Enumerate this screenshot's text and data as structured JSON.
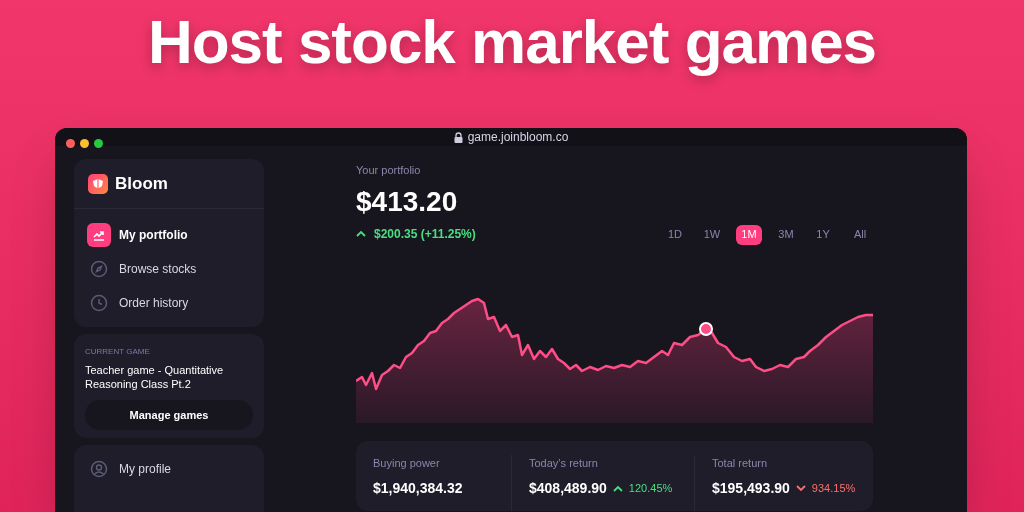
{
  "headline": "Host stock market games",
  "window": {
    "url": "game.joinbloom.co"
  },
  "sidebar": {
    "brand": "Bloom",
    "nav_items": [
      {
        "label": "My portfolio",
        "selected": true
      },
      {
        "label": "Browse stocks",
        "selected": false
      },
      {
        "label": "Order history",
        "selected": false
      }
    ],
    "current_game": {
      "label": "CURRENT GAME",
      "title": "Teacher game - Quantitative Reasoning Class Pt.2",
      "button": "Manage games"
    },
    "account_items": [
      {
        "label": "My profile"
      }
    ]
  },
  "portfolio": {
    "label": "Your portfolio",
    "value": "$413.20",
    "change": {
      "text": "$200.35 (+11.25%)",
      "kind": "up"
    }
  },
  "ranges": [
    {
      "label": "1D",
      "selected": false
    },
    {
      "label": "1W",
      "selected": false
    },
    {
      "label": "1M",
      "selected": true
    },
    {
      "label": "3M",
      "selected": false
    },
    {
      "label": "1Y",
      "selected": false
    },
    {
      "label": "All",
      "selected": false
    }
  ],
  "stats": [
    {
      "label": "Buying power",
      "value": "$1,940,384.32"
    },
    {
      "label": "Today’s return",
      "value": "$408,489.90",
      "change": {
        "text": "120.45%",
        "kind": "up"
      }
    },
    {
      "label": "Total return",
      "value": "$195,493.90",
      "change": {
        "text": "934.15%",
        "kind": "down"
      }
    }
  ]
}
